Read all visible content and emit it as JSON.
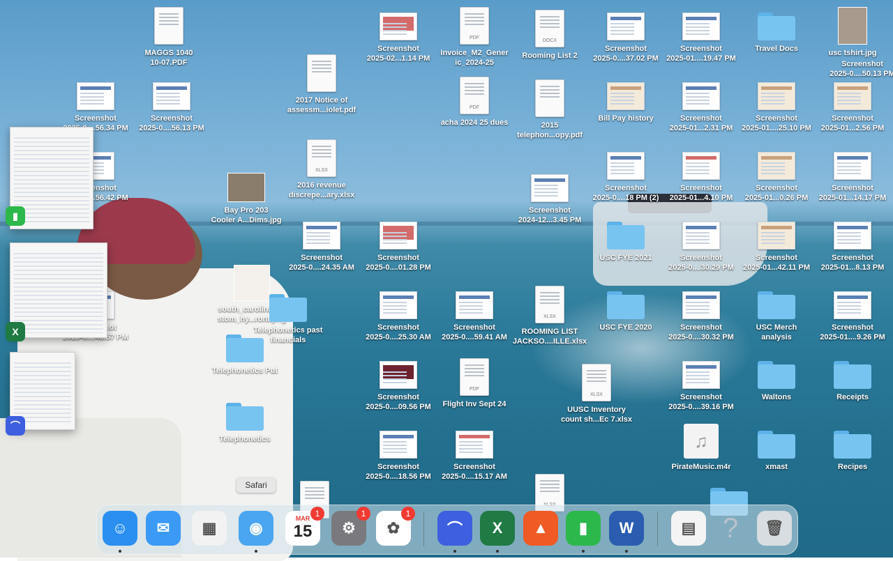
{
  "tooltip": "Safari",
  "desktop_items": [
    {
      "label": "MAGGS 1040\n10-07.PDF",
      "kind": "doc",
      "tag": ""
    },
    {
      "label": "2017  Notice of\nassessm...iolet.pdf",
      "kind": "doc",
      "tag": ""
    },
    {
      "label": "2016  revenue\ndiscrepe...ary.xlsx",
      "kind": "doc",
      "tag": "XLSX"
    },
    {
      "label": "Screenshot\n2025-02...1.14 PM",
      "kind": "shot",
      "tag": ""
    },
    {
      "label": "Invoice_M2_Gener\nic_2024-25",
      "kind": "doc",
      "tag": "PDF"
    },
    {
      "label": "Rooming List 2",
      "kind": "doc",
      "tag": "DOCX"
    },
    {
      "label": "Screenshot\n2025-0....37.02 PM",
      "kind": "shot",
      "tag": ""
    },
    {
      "label": "Screenshot\n2025-01....19.47 PM",
      "kind": "shot",
      "tag": ""
    },
    {
      "label": "Travel Docs",
      "kind": "folder",
      "tag": ""
    },
    {
      "label": "usc tshirt.jpg",
      "kind": "photo",
      "tag": ""
    },
    {
      "label": "Screenshot\n2025-0....50.13 PM",
      "kind": "none",
      "tag": ""
    },
    {
      "label": "Screenshot\n2025-0....56.34 PM",
      "kind": "shot",
      "tag": ""
    },
    {
      "label": "Screenshot\n2025-0....56.13 PM",
      "kind": "shot",
      "tag": ""
    },
    {
      "label": "acha 2024 25 dues",
      "kind": "doc",
      "tag": "PDF"
    },
    {
      "label": "2015\ntelephon...opy.pdf",
      "kind": "doc",
      "tag": ""
    },
    {
      "label": "Bill Pay history",
      "kind": "shot",
      "tag": ""
    },
    {
      "label": "Screenshot\n2025-01...2.31 PM",
      "kind": "shot",
      "tag": ""
    },
    {
      "label": "Screenshot\n2025-01....25.10 PM",
      "kind": "shot",
      "tag": ""
    },
    {
      "label": "Screenshot\n2025-01...2.56 PM",
      "kind": "shot",
      "tag": ""
    },
    {
      "label": "Screenshot\n2025-0....56.42 PM",
      "kind": "shot",
      "tag": ""
    },
    {
      "label": "Bay Pro 203\nCooler A...Dims.jpg",
      "kind": "photo",
      "tag": ""
    },
    {
      "label": "Screenshot\n2024-12...3.45 PM",
      "kind": "shot",
      "tag": ""
    },
    {
      "label": "Screenshot\n2025-0....18 PM (2)",
      "kind": "shot",
      "tag": ""
    },
    {
      "label": "Screenshot\n2025-01...4.10 PM",
      "kind": "shot",
      "tag": ""
    },
    {
      "label": "Screenshot\n2025-01...0.26 PM",
      "kind": "shot",
      "tag": ""
    },
    {
      "label": "Screenshot\n2025-01...14.17 PM",
      "kind": "shot",
      "tag": ""
    },
    {
      "label": "Screenshot\n2025-0....24.35 AM",
      "kind": "shot",
      "tag": ""
    },
    {
      "label": "Screenshot\n2025-0....01.28 PM",
      "kind": "shot",
      "tag": ""
    },
    {
      "label": "USC FYE 2021",
      "kind": "folder",
      "tag": ""
    },
    {
      "label": "Screenshot\n2025-0....30.29 PM",
      "kind": "shot",
      "tag": ""
    },
    {
      "label": "Screenshot\n2025-01...42.11 PM",
      "kind": "shot",
      "tag": ""
    },
    {
      "label": "Screenshot\n2025-01...8.13 PM",
      "kind": "shot",
      "tag": ""
    },
    {
      "label": "south_carolina_cu\nstom_hy...ront.png",
      "kind": "photo",
      "tag": ""
    },
    {
      "label": "Screenshot\n2025-0....48.57 PM",
      "kind": "shot",
      "tag": ""
    },
    {
      "label": "Telephonetics past\nfinancials",
      "kind": "folder",
      "tag": ""
    },
    {
      "label": "Screenshot\n2025-0....25.30 AM",
      "kind": "shot",
      "tag": ""
    },
    {
      "label": "Screenshot\n2025-0....59.41 AM",
      "kind": "shot",
      "tag": ""
    },
    {
      "label": "ROOMING LIST\nJACKSO....ILLE.xlsx",
      "kind": "doc",
      "tag": "XLSX"
    },
    {
      "label": "USC FYE 2020",
      "kind": "folder",
      "tag": ""
    },
    {
      "label": "Screenshot\n2025-0....30.32 PM",
      "kind": "shot",
      "tag": ""
    },
    {
      "label": "USC Merch\nanalysis",
      "kind": "folder",
      "tag": ""
    },
    {
      "label": "Screenshot\n2025-01....9.26 PM",
      "kind": "shot",
      "tag": ""
    },
    {
      "label": "Telephonetics Put",
      "kind": "folder",
      "tag": ""
    },
    {
      "label": "Screenshot\n2025-0....09.56 PM",
      "kind": "shot",
      "tag": ""
    },
    {
      "label": "Flight Inv Sept 24",
      "kind": "doc",
      "tag": "PDF"
    },
    {
      "label": "UUSC Inventory\ncount sh...Ec 7.xlsx",
      "kind": "doc",
      "tag": "XLSX"
    },
    {
      "label": "Screenshot\n2025-0....39.16 PM",
      "kind": "shot",
      "tag": ""
    },
    {
      "label": "Waltons",
      "kind": "folder",
      "tag": ""
    },
    {
      "label": "Receipts",
      "kind": "folder",
      "tag": ""
    },
    {
      "label": "Telephonetics",
      "kind": "folder",
      "tag": ""
    },
    {
      "label": "Screenshot\n2025-0....18.56 PM",
      "kind": "shot",
      "tag": ""
    },
    {
      "label": "Screenshot\n2025-0....15.17 AM",
      "kind": "shot",
      "tag": ""
    },
    {
      "label": "PirateMusic.m4r",
      "kind": "music",
      "tag": ""
    },
    {
      "label": "xmast",
      "kind": "folder",
      "tag": ""
    },
    {
      "label": "Recipes",
      "kind": "folder",
      "tag": ""
    },
    {
      "label": "",
      "kind": "doc",
      "tag": ""
    },
    {
      "label": "",
      "kind": "doc",
      "tag": "XLSX"
    },
    {
      "label": "",
      "kind": "folder",
      "tag": ""
    }
  ],
  "stage_apps": [
    {
      "name": "numbers-icon",
      "glyph": "▮",
      "color": "#2db84c"
    },
    {
      "name": "excel-icon",
      "glyph": "X",
      "color": "#1f7a43"
    },
    {
      "name": "nordvpn-icon",
      "glyph": "⌒",
      "color": "#3e5fe0"
    }
  ],
  "dock_apps": [
    {
      "name": "finder",
      "glyph": "☺",
      "color": "#2a8ff0",
      "badge": "",
      "running": true
    },
    {
      "name": "mail",
      "glyph": "✉",
      "color": "#3a9af5",
      "badge": "",
      "running": false
    },
    {
      "name": "launchpad",
      "glyph": "▦",
      "color": "#f2f2f2",
      "badge": "",
      "running": false
    },
    {
      "name": "safari",
      "glyph": "◉",
      "color": "#4aa6f0",
      "badge": "",
      "running": true
    },
    {
      "name": "calendar",
      "glyph": "15",
      "color": "#ffffff",
      "badge": "1",
      "running": false,
      "month": "MAR"
    },
    {
      "name": "system-settings",
      "glyph": "⚙",
      "color": "#7a7a7e",
      "badge": "1",
      "running": false
    },
    {
      "name": "photos",
      "glyph": "✿",
      "color": "#ffffff",
      "badge": "1",
      "running": false
    },
    {
      "name": "nordvpn",
      "glyph": "⌒",
      "color": "#3e5fe0",
      "badge": "",
      "running": true
    },
    {
      "name": "excel",
      "glyph": "X",
      "color": "#1f7a43",
      "badge": "",
      "running": true
    },
    {
      "name": "brave",
      "glyph": "▲",
      "color": "#f05a24",
      "badge": "",
      "running": false
    },
    {
      "name": "numbers",
      "glyph": "▮",
      "color": "#2db84c",
      "badge": "",
      "running": true
    },
    {
      "name": "word",
      "glyph": "W",
      "color": "#2a5db0",
      "badge": "",
      "running": true
    },
    {
      "name": "recent-pdf",
      "glyph": "▤",
      "color": "#f4f4f4",
      "badge": "",
      "running": false
    },
    {
      "name": "unknown-app",
      "glyph": "?",
      "color": "transparent",
      "badge": "",
      "running": false
    },
    {
      "name": "trash",
      "glyph": "🗑",
      "color": "#d8dde2",
      "badge": "",
      "running": false
    }
  ]
}
